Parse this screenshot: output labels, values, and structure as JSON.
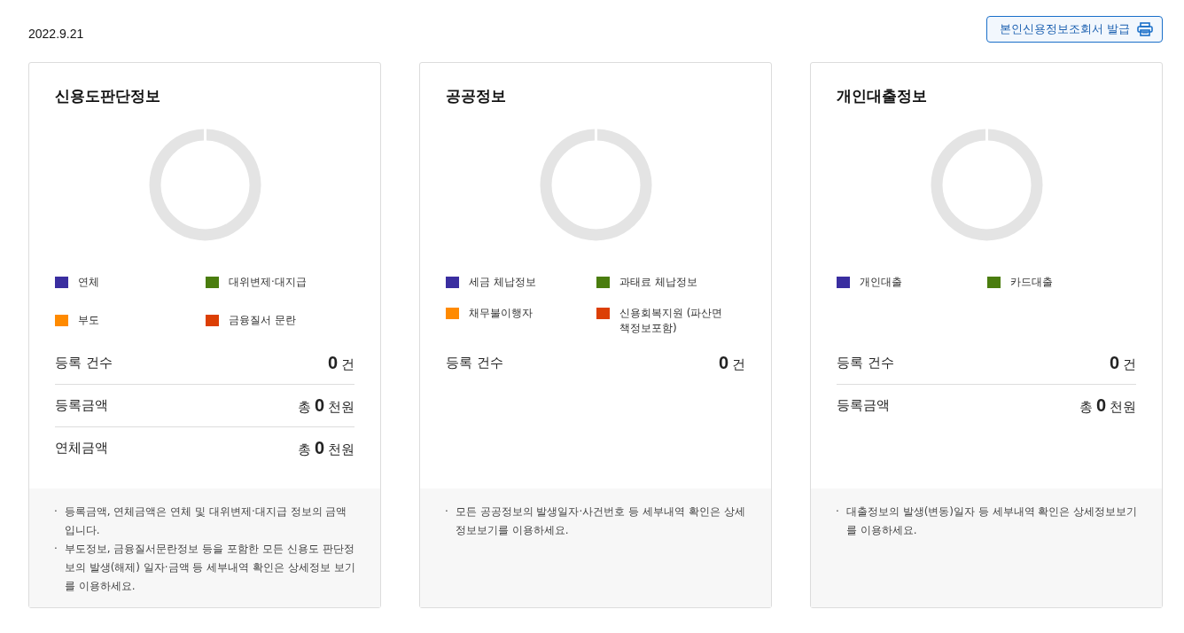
{
  "date": "2022.9.21",
  "issue_button": {
    "label": "본인신용정보조회서 발급"
  },
  "cards": [
    {
      "title": "신용도판단정보",
      "legend": [
        {
          "label": "연체",
          "color": "#3a2ea0"
        },
        {
          "label": "대위변제·대지급",
          "color": "#4a7d0e"
        },
        {
          "label": "부도",
          "color": "#ff8a00"
        },
        {
          "label": "금융질서 문란",
          "color": "#dc3f04"
        }
      ],
      "stats": [
        {
          "label": "등록 건수",
          "value": "0",
          "unit": "건"
        },
        {
          "label": "등록금액",
          "prefix": "총",
          "value": "0",
          "unit": "천원"
        },
        {
          "label": "연체금액",
          "prefix": "총",
          "value": "0",
          "unit": "천원"
        }
      ],
      "notes": [
        {
          "bullet": "·",
          "text": "등록금액, 연체금액은 연체 및 대위변제·대지급 정보의 금액 입니다."
        },
        {
          "bullet": "·",
          "text": "부도정보, 금융질서문란정보 등을 포함한 모든 신용도 판단정보의 발생(해제) 일자·금액 등 세부내역 확인은 상세정보 보기를 이용하세요."
        }
      ]
    },
    {
      "title": "공공정보",
      "legend": [
        {
          "label": "세금 체납정보",
          "color": "#3a2ea0"
        },
        {
          "label": "과태료 체납정보",
          "color": "#4a7d0e"
        },
        {
          "label": "채무불이행자",
          "color": "#ff8a00"
        },
        {
          "label": "신용회복지원 (파산면책정보포함)",
          "color": "#dc3f04"
        }
      ],
      "stats": [
        {
          "label": "등록 건수",
          "value": "0",
          "unit": "건"
        }
      ],
      "notes": [
        {
          "bullet": "·",
          "text": "모든 공공정보의 발생일자·사건번호 등 세부내역 확인은 상세정보보기를 이용하세요."
        }
      ]
    },
    {
      "title": "개인대출정보",
      "legend": [
        {
          "label": "개인대출",
          "color": "#3a2ea0"
        },
        {
          "label": "카드대출",
          "color": "#4a7d0e"
        }
      ],
      "stats": [
        {
          "label": "등록 건수",
          "value": "0",
          "unit": "건"
        },
        {
          "label": "등록금액",
          "prefix": "총",
          "value": "0",
          "unit": "천원"
        }
      ],
      "notes": [
        {
          "bullet": "·",
          "text": "대출정보의 발생(변동)일자 등 세부내역 확인은 상세정보보기를 이용하세요."
        }
      ]
    }
  ]
}
